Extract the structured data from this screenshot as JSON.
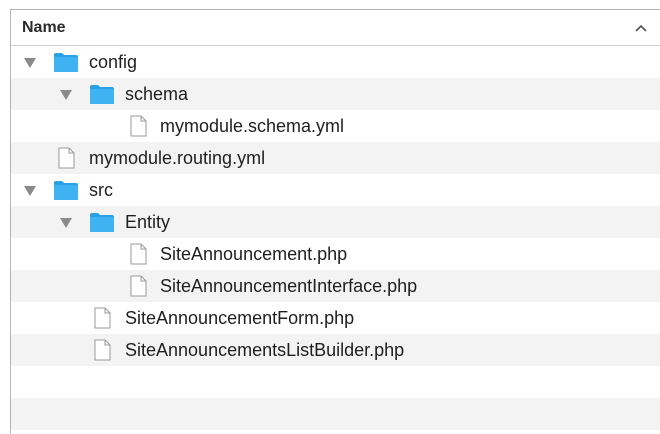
{
  "header": {
    "name_label": "Name",
    "sort_icon": "chevron-up-icon"
  },
  "rows": [
    {
      "label": "config",
      "kind": "folder",
      "expanded": true
    },
    {
      "label": "schema",
      "kind": "folder",
      "expanded": true
    },
    {
      "label": "mymodule.schema.yml",
      "kind": "file"
    },
    {
      "label": "mymodule.routing.yml",
      "kind": "file"
    },
    {
      "label": "src",
      "kind": "folder",
      "expanded": true
    },
    {
      "label": "Entity",
      "kind": "folder",
      "expanded": true
    },
    {
      "label": "SiteAnnouncement.php",
      "kind": "file"
    },
    {
      "label": "SiteAnnouncementInterface.php",
      "kind": "file"
    },
    {
      "label": "SiteAnnouncementForm.php",
      "kind": "file"
    },
    {
      "label": "SiteAnnouncementsListBuilder.php",
      "kind": "file"
    }
  ],
  "colors": {
    "folder": "#3fb3f2",
    "folder_dark": "#2aa0e6",
    "alt_row": "#f3f3f3",
    "disclosure": "#8a8a8a"
  }
}
